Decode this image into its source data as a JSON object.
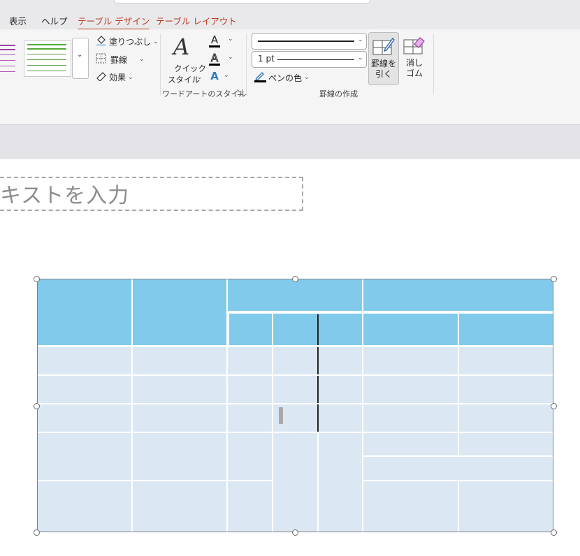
{
  "tabs": [
    {
      "label": "表示"
    },
    {
      "label": "ヘルプ"
    },
    {
      "label": "テーブル デザイン",
      "active": true
    },
    {
      "label": "テーブル レイアウト"
    }
  ],
  "ribbon": {
    "shading_label": "塗りつぶし",
    "borders_label": "罫線",
    "effects_label": "効果",
    "quick_style_line1": "クイック",
    "quick_style_line2": "スタイル",
    "wordart_group_label": "ワードアートのスタイル",
    "pen_weight": "1 pt",
    "pen_color_label": "ペンの色",
    "draw_borders_group_label": "罫線の作成",
    "draw_table_line1": "罫線を",
    "draw_table_line2": "引く",
    "eraser_line1": "消し",
    "eraser_line2": "ゴム"
  },
  "slide": {
    "title_placeholder": "キストを入力"
  },
  "colors": {
    "accent": "#b83b1e",
    "header_fill": "#82caeb",
    "body_fill": "#dbe8f4",
    "gallery_purple": "#a03fa0",
    "gallery_green": "#55a83a"
  }
}
